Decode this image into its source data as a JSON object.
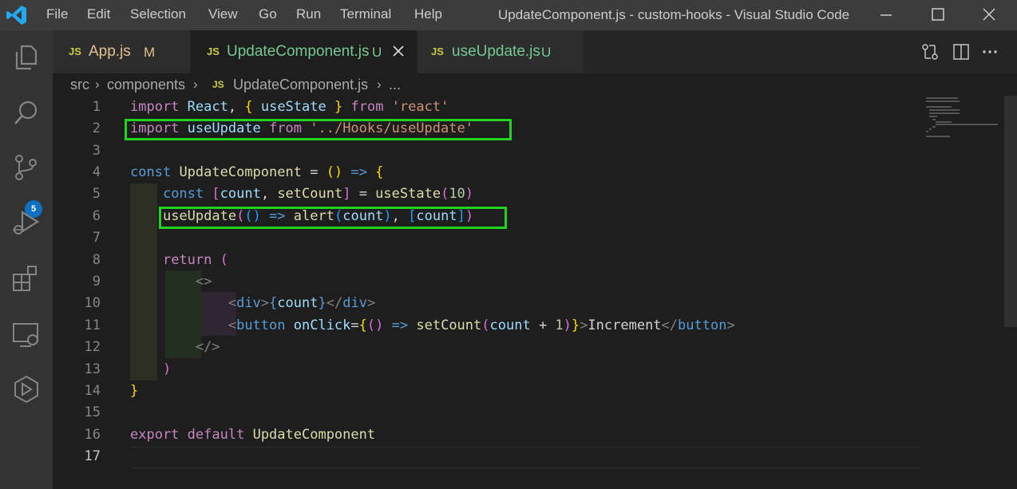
{
  "titlebar": {
    "menu": [
      "File",
      "Edit",
      "Selection",
      "View",
      "Go",
      "Run",
      "Terminal",
      "Help"
    ],
    "title": "UpdateComponent.js - custom-hooks - Visual Studio Code"
  },
  "activity_bar": {
    "icons": [
      "explorer-icon",
      "search-icon",
      "source-control-icon",
      "run-debug-icon",
      "extensions-icon",
      "remote-explorer-icon",
      "deploy-icon"
    ],
    "source_control_badge": "5"
  },
  "tabs": [
    {
      "icon": "JS",
      "name": "App.js",
      "status": "M",
      "active": false
    },
    {
      "icon": "JS",
      "name": "UpdateComponent.js",
      "status": "U",
      "active": true
    },
    {
      "icon": "JS",
      "name": "useUpdate.js",
      "status": "U",
      "active": false
    }
  ],
  "breadcrumb": {
    "parts": [
      "src",
      "components",
      "UpdateComponent.js",
      "..."
    ],
    "file_icon": "JS"
  },
  "editor": {
    "line_numbers": [
      "1",
      "2",
      "3",
      "4",
      "5",
      "6",
      "7",
      "8",
      "9",
      "10",
      "11",
      "12",
      "13",
      "14",
      "15",
      "16",
      "17"
    ],
    "current_line": 17,
    "lines": [
      "import React, { useState } from 'react'",
      "import useUpdate from '../Hooks/useUpdate'",
      "",
      "const UpdateComponent = () => {",
      "    const [count, setCount] = useState(10)",
      "    useUpdate(() => alert(count), [count])",
      "",
      "    return (",
      "        <>",
      "            <div>{count}</div>",
      "            <button onClick={() => setCount(count + 1)}>Increment</button>",
      "        </>",
      "    )",
      "}",
      "",
      "export default UpdateComponent",
      ""
    ],
    "highlighted_lines": [
      2,
      6
    ],
    "highlight_color": "#1fd31f"
  },
  "colors": {
    "keyword": "#c586c0",
    "storage": "#569cd6",
    "variable": "#9cdcfe",
    "function": "#dcdcaa",
    "string": "#ce9178",
    "number": "#b5cea8",
    "js_icon": "#cbcb41",
    "modified": "#e2c08d",
    "untracked": "#73c991"
  }
}
